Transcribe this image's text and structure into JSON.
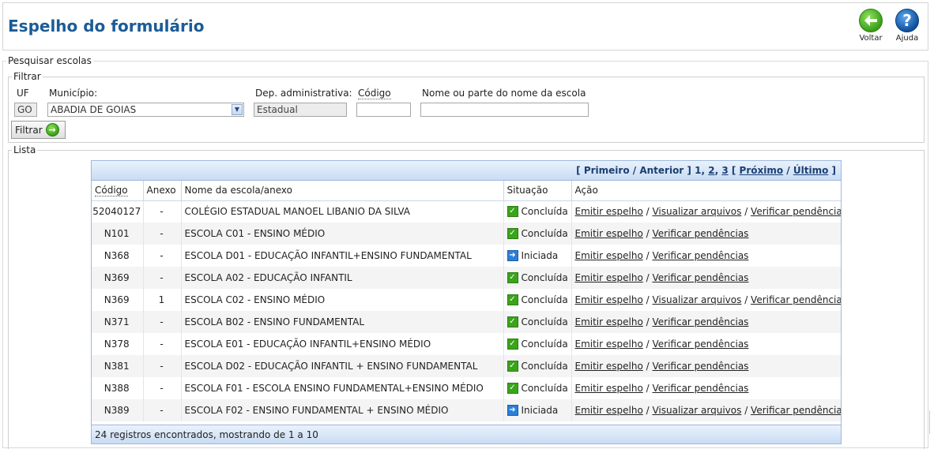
{
  "header": {
    "title": "Espelho do formulário",
    "back_label": "Voltar",
    "help_label": "Ajuda",
    "help_glyph": "?",
    "back_glyph": "←"
  },
  "search": {
    "legend": "Pesquisar escolas",
    "filter_legend": "Filtrar",
    "uf_label": "UF",
    "uf_value": "GO",
    "municipio_label": "Município:",
    "municipio_value": "ABADIA DE GOIAS",
    "dep_label": "Dep. administrativa:",
    "dep_value": "Estadual",
    "codigo_label": "Código",
    "codigo_value": "",
    "nome_label": "Nome ou parte do nome da escola",
    "nome_value": "",
    "filter_button": "Filtrar"
  },
  "list": {
    "legend": "Lista",
    "pager": {
      "open": "[",
      "first": "Primeiro",
      "slash": "/",
      "previous": "Anterior",
      "close": "]",
      "page1": "1",
      "page2": "2",
      "page3": "3",
      "next": "Próximo",
      "last": "Último"
    },
    "columns": [
      "Código",
      "Anexo",
      "Nome da escola/anexo",
      "Situação",
      "Ação"
    ],
    "actions": {
      "emit": "Emitir espelho",
      "view": "Visualizar arquivos",
      "verify": "Verificar pendências",
      "sep": " / "
    },
    "rows": [
      {
        "codigo": "52040127",
        "anexo": "-",
        "nome": "COLÉGIO ESTADUAL MANOEL LIBANIO DA SILVA",
        "situacao": "Concluída",
        "status_icon": "check-icon",
        "has_view": true
      },
      {
        "codigo": "N101",
        "anexo": "-",
        "nome": "ESCOLA C01 - ENSINO MÉDIO",
        "situacao": "Concluída",
        "status_icon": "check-icon",
        "has_view": false
      },
      {
        "codigo": "N368",
        "anexo": "-",
        "nome": "ESCOLA D01 - EDUCAÇÃO INFANTIL+ENSINO FUNDAMENTAL",
        "situacao": "Iniciada",
        "status_icon": "arrow-icon",
        "has_view": false
      },
      {
        "codigo": "N369",
        "anexo": "-",
        "nome": "ESCOLA A02 - EDUCAÇÃO INFANTIL",
        "situacao": "Concluída",
        "status_icon": "check-icon",
        "has_view": false
      },
      {
        "codigo": "N369",
        "anexo": "1",
        "nome": "ESCOLA C02 - ENSINO MÉDIO",
        "situacao": "Concluída",
        "status_icon": "check-icon",
        "has_view": true
      },
      {
        "codigo": "N371",
        "anexo": "-",
        "nome": "ESCOLA B02 - ENSINO FUNDAMENTAL",
        "situacao": "Concluída",
        "status_icon": "check-icon",
        "has_view": false
      },
      {
        "codigo": "N378",
        "anexo": "-",
        "nome": "ESCOLA E01 - EDUCAÇÃO INFANTIL+ENSINO MÉDIO",
        "situacao": "Concluída",
        "status_icon": "check-icon",
        "has_view": false
      },
      {
        "codigo": "N381",
        "anexo": "-",
        "nome": "ESCOLA D02 - EDUCAÇÃO INFANTIL + ENSINO FUNDAMENTAL",
        "situacao": "Concluída",
        "status_icon": "check-icon",
        "has_view": false
      },
      {
        "codigo": "N388",
        "anexo": "-",
        "nome": "ESCOLA F01 - ESCOLA ENSINO FUNDAMENTAL+ENSINO MÉDIO",
        "situacao": "Concluída",
        "status_icon": "check-icon",
        "has_view": false
      },
      {
        "codigo": "N389",
        "anexo": "-",
        "nome": "ESCOLA F02 - ENSINO FUNDAMENTAL + ENSINO MÉDIO",
        "situacao": "Iniciada",
        "status_icon": "arrow-icon",
        "has_view": true
      }
    ],
    "footer": "24 registros encontrados, mostrando de 1 a 10"
  }
}
